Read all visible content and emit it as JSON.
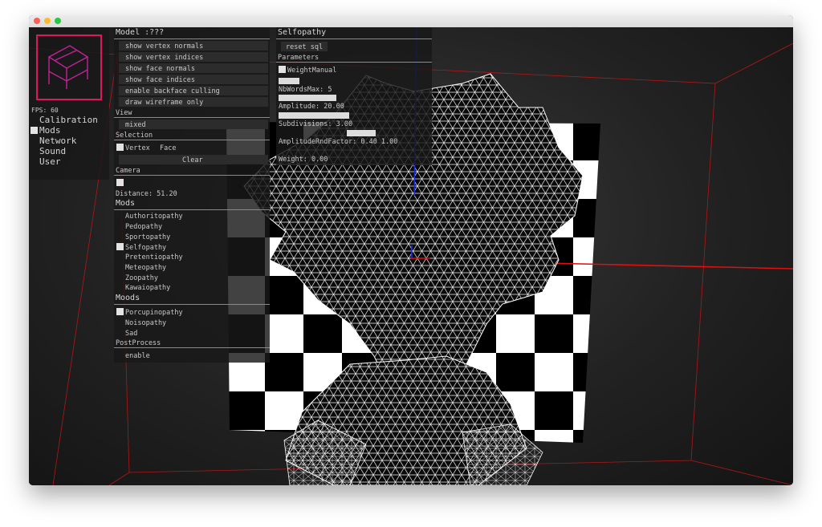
{
  "sidebar": {
    "fps": "FPS: 60",
    "tabs": [
      "Calibration",
      "Mods",
      "Network",
      "Sound",
      "User"
    ]
  },
  "model_panel": {
    "title": "Model :???",
    "options": [
      "show vertex normals",
      "show vertex indices",
      "show face normals",
      "show face indices",
      "enable backface culling",
      "draw wireframe only"
    ],
    "view_label": "View",
    "view_value": "mixed",
    "selection_label": "Selection",
    "selection_vertex": "Vertex",
    "selection_face": "Face",
    "clear_label": "Clear",
    "camera_label": "Camera",
    "distance": "Distance: 51.20",
    "mods_label": "Mods",
    "mods": [
      "Authoritopathy",
      "Pedopathy",
      "Sportopathy",
      "Selfopathy",
      "Pretentiopathy",
      "Meteopathy",
      "Zoopathy",
      "Kawaiopathy"
    ],
    "moods_label": "Moods",
    "moods": [
      "Porcupinopathy",
      "Noisopathy",
      "Sad"
    ],
    "postprocess_label": "PostProcess",
    "postprocess_enable": "enable"
  },
  "selfopathy_panel": {
    "title": "Selfopathy",
    "reset": "reset sql",
    "parameters_label": "Parameters",
    "weight_manual": "WeightManual",
    "nbwords": "NbWordsMax: 5",
    "amplitude": "Amplitude: 20.00",
    "subdivisions": "Subdivisions: 3.00",
    "amplitude_rnd": "AmplitudeRndFactor: 0.40 1.00",
    "weight": "Weight: 0.00"
  },
  "colors": {
    "accent_magenta": "#c3229a",
    "logo_border": "#e0185a",
    "axis_red": "#e01010",
    "axis_blue": "#1a2ae0"
  }
}
